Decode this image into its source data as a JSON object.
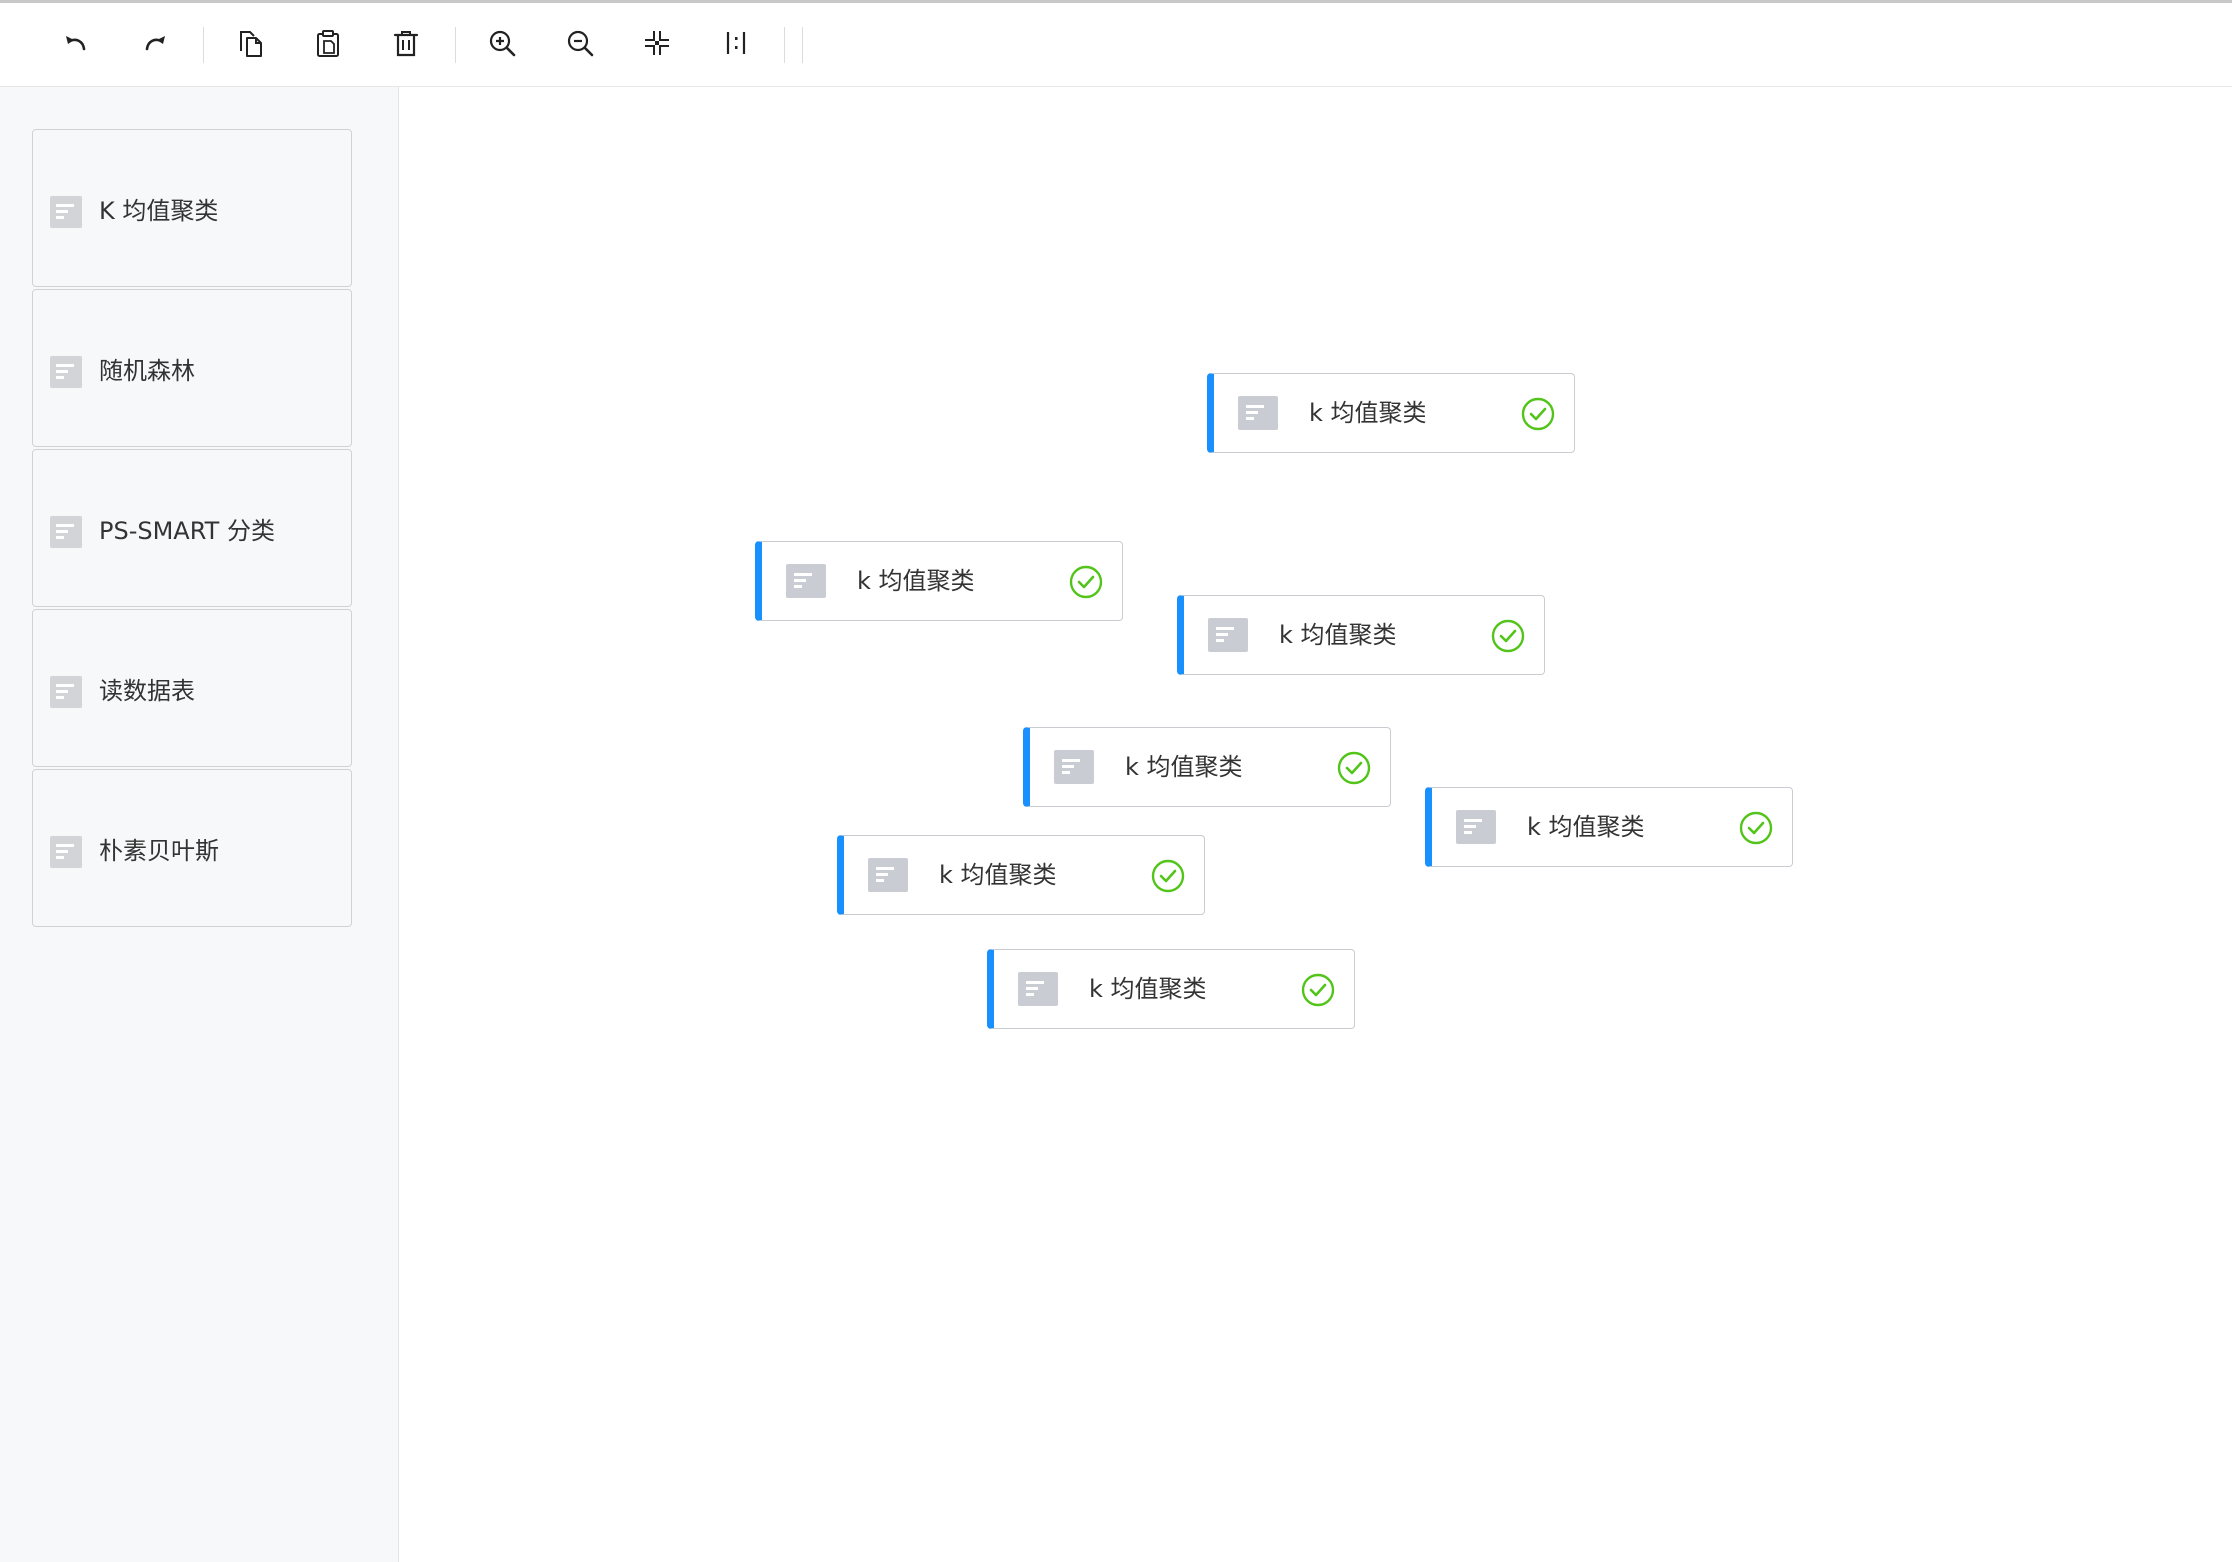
{
  "toolbar": {
    "buttons": [
      {
        "name": "undo",
        "icon": "undo-icon"
      },
      {
        "name": "redo",
        "icon": "redo-icon"
      },
      {
        "name": "copy",
        "icon": "copy-icon"
      },
      {
        "name": "paste",
        "icon": "paste-icon"
      },
      {
        "name": "delete",
        "icon": "trash-icon"
      },
      {
        "name": "zoom-in",
        "icon": "zoom-in-icon"
      },
      {
        "name": "zoom-out",
        "icon": "zoom-out-icon"
      },
      {
        "name": "fit-view",
        "icon": "fit-view-icon"
      },
      {
        "name": "actual-size",
        "icon": "actual-size-icon"
      }
    ]
  },
  "sidebar": {
    "items": [
      {
        "label": "K 均值聚类",
        "icon": "node-type-icon"
      },
      {
        "label": "随机森林",
        "icon": "node-type-icon"
      },
      {
        "label": "PS-SMART 分类",
        "icon": "node-type-icon"
      },
      {
        "label": "读数据表",
        "icon": "node-type-icon"
      },
      {
        "label": "朴素贝叶斯",
        "icon": "node-type-icon"
      }
    ]
  },
  "canvas": {
    "nodes": [
      {
        "label": "k 均值聚类",
        "status": "success"
      },
      {
        "label": "k 均值聚类",
        "status": "success"
      },
      {
        "label": "k 均值聚类",
        "status": "success"
      },
      {
        "label": "k 均值聚类",
        "status": "success"
      },
      {
        "label": "k 均值聚类",
        "status": "success"
      },
      {
        "label": "k 均值聚类",
        "status": "success"
      },
      {
        "label": "k 均值聚类",
        "status": "success"
      }
    ]
  },
  "colors": {
    "accent": "#1890ff",
    "success": "#52c41a",
    "icon_bg": "#c9ccd2",
    "sidebar_bg": "#f7f8fa"
  }
}
